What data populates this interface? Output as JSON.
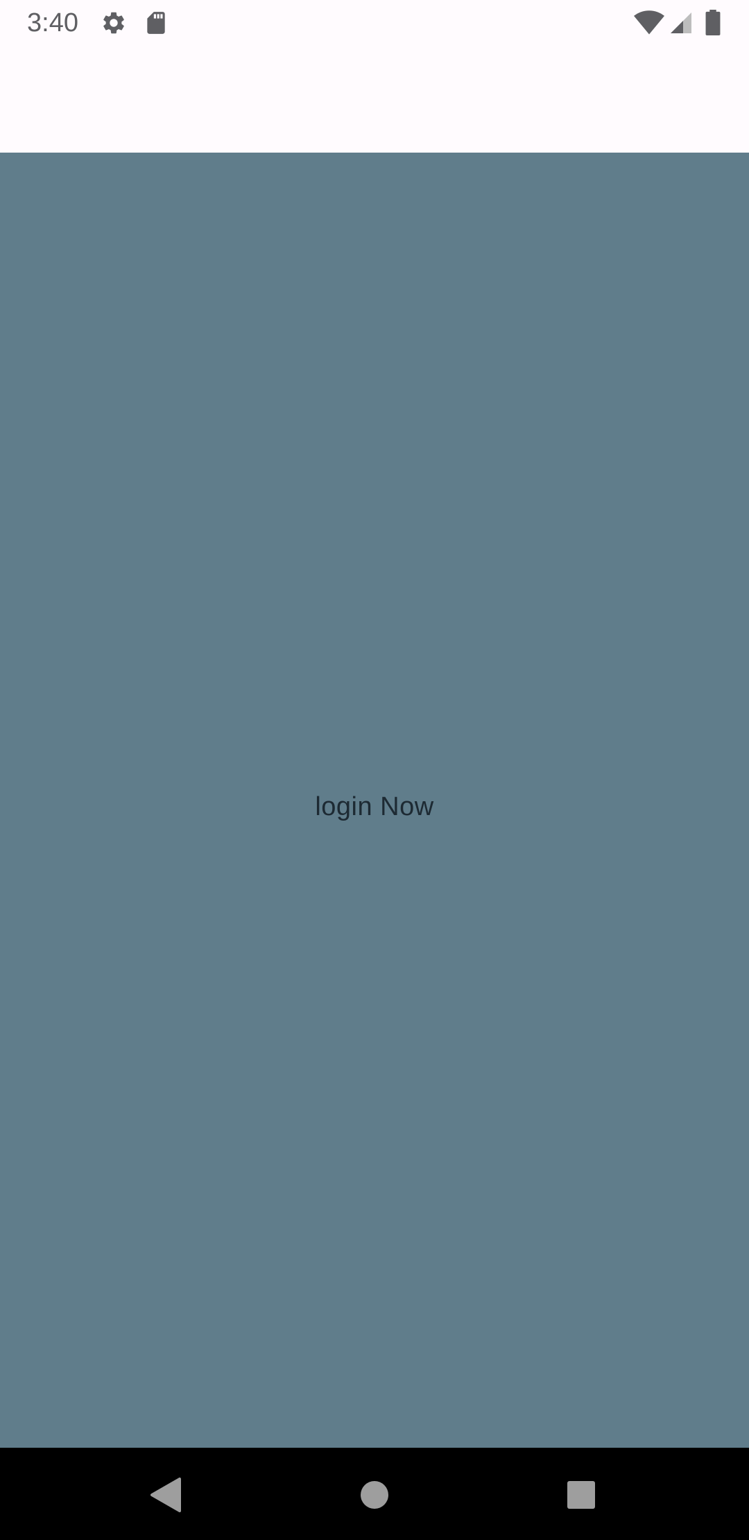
{
  "status_bar": {
    "time": "3:40",
    "icons": [
      "gear-icon",
      "sd-card-icon",
      "wifi-icon",
      "cellular-signal-icon",
      "battery-icon"
    ],
    "icon_color": "#5f5f63"
  },
  "app_bar": {
    "background": "#fffbfe"
  },
  "main": {
    "background": "#607d8b",
    "login_label": "login Now",
    "text_color": "#1d2a33"
  },
  "nav_bar": {
    "buttons": [
      "back-icon",
      "home-icon",
      "recents-icon"
    ],
    "background": "#000000",
    "icon_color": "#9e9e9e"
  }
}
